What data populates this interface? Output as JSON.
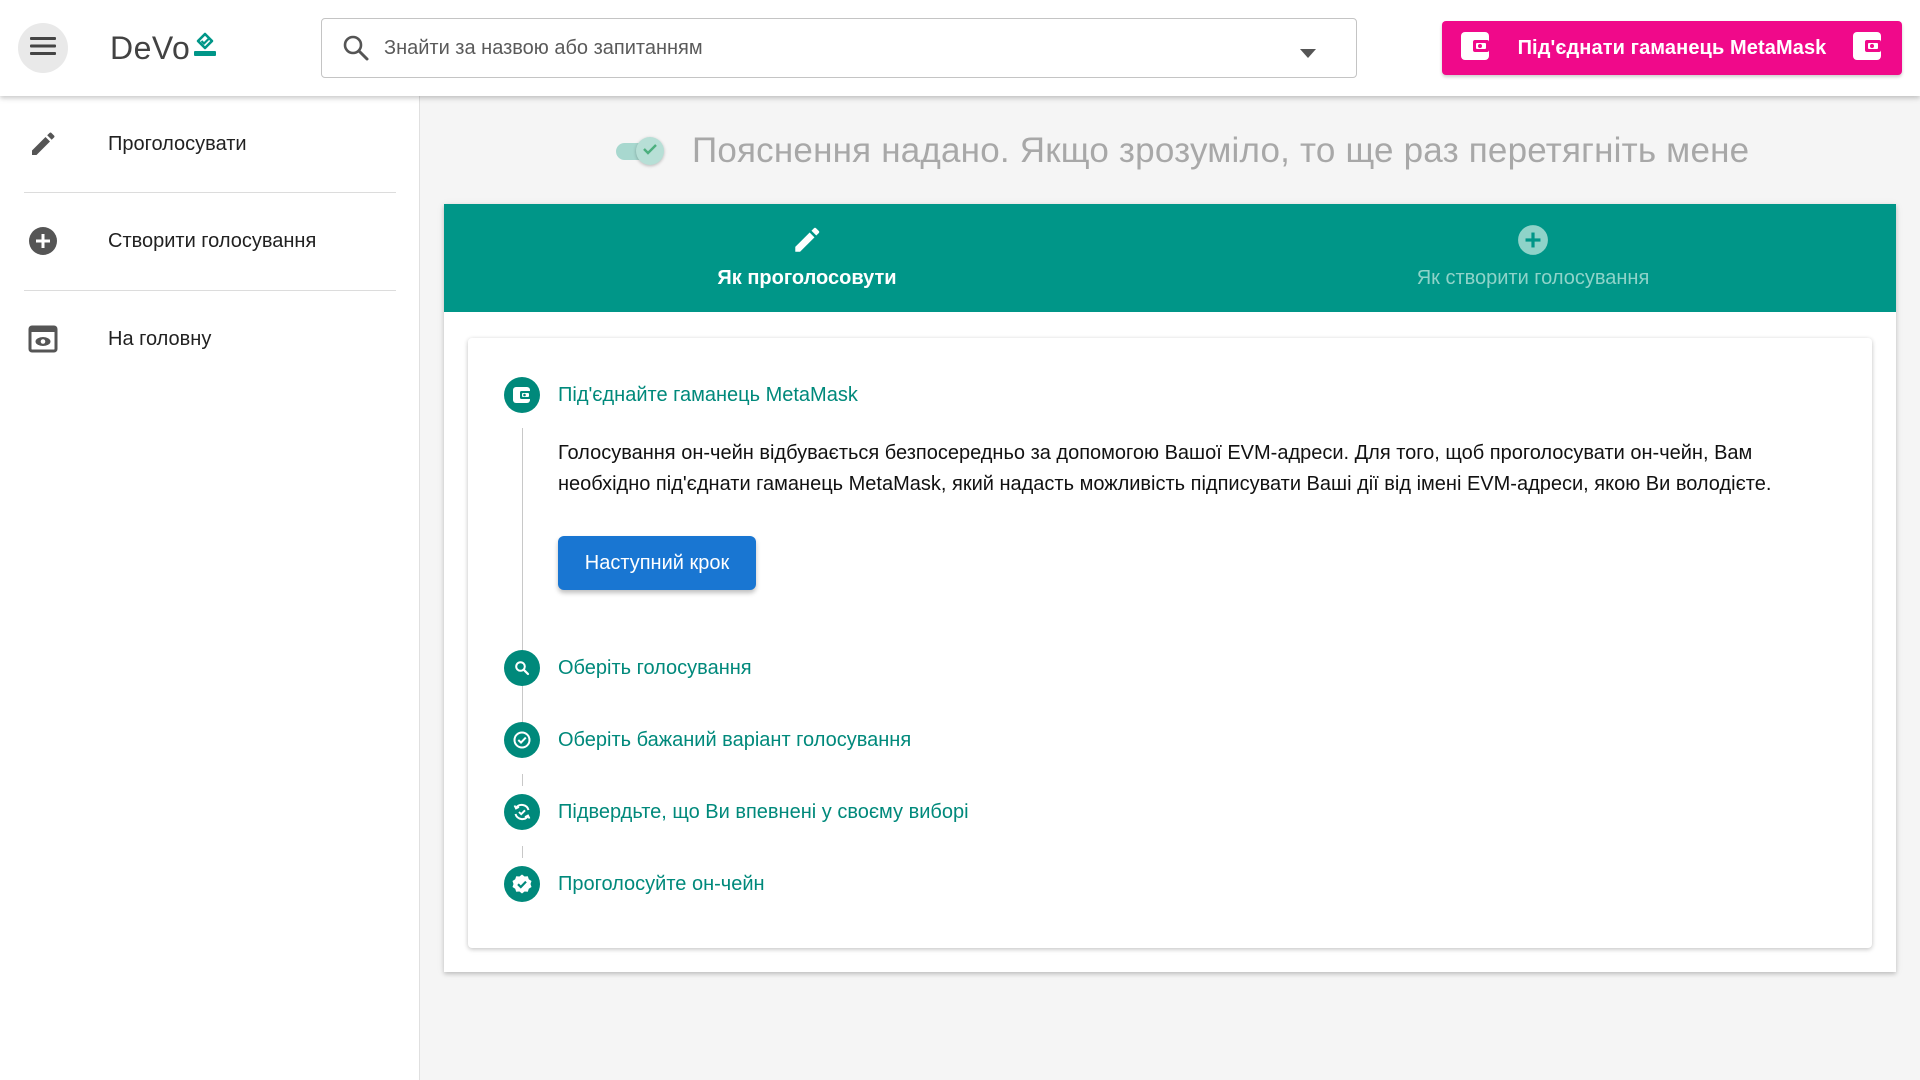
{
  "app": {
    "logo_text": "DeVo"
  },
  "header": {
    "search": {
      "placeholder": "Знайти за назвою або запитанням"
    },
    "metamask_button": {
      "label": "Під'єднати гаманець MetaMask",
      "color": "#f0098a"
    }
  },
  "sidebar": {
    "items": [
      {
        "label": "Проголосувати",
        "icon": "pencil-icon"
      },
      {
        "label": "Створити голосування",
        "icon": "add-circle-icon"
      },
      {
        "label": "На головну",
        "icon": "home-preview-icon"
      }
    ]
  },
  "main": {
    "hint": {
      "text": "Пояснення надано. Якщо зрозуміло, то ще раз перетягніть мене",
      "toggle_checked": true
    },
    "tabs": [
      {
        "label": "Як проголосовути",
        "icon": "pencil-icon",
        "active": true
      },
      {
        "label": "Як створити голосування",
        "icon": "add-circle-icon",
        "active": false
      }
    ],
    "steps": [
      {
        "title": "Під'єднайте гаманець MetaMask",
        "icon": "wallet-icon",
        "description": "Голосування он-чейн відбувається безпосередньо за допомогою Вашої EVM-адреси. Для того, щоб проголосувати он-чейн, Вам необхідно під'єднати гаманець MetaMask, який надасть можливість підписувати Ваші дії від імені EVM-адреси, якою Ви володієте.",
        "button_label": "Наступний крок"
      },
      {
        "title": "Оберіть голосування",
        "icon": "search-icon"
      },
      {
        "title": "Оберіть бажаний варіант голосування",
        "icon": "check-circle-icon"
      },
      {
        "title": "Підвердьте, що Ви впевнені у своєму виборі",
        "icon": "refresh-check-icon"
      },
      {
        "title": "Проголосуйте он-чейн",
        "icon": "verified-badge-icon"
      }
    ]
  },
  "colors": {
    "primary": "#009688",
    "step_accent": "#00897b",
    "button_blue": "#1976d2"
  }
}
